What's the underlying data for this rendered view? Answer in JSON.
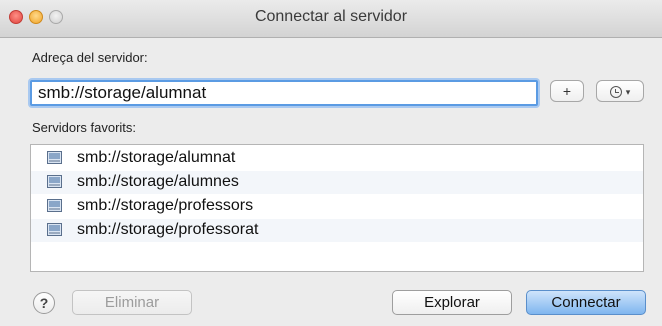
{
  "window": {
    "title": "Connectar al servidor"
  },
  "address": {
    "label": "Adreça del servidor:",
    "value": "smb://storage/alumnat"
  },
  "toolbar": {
    "add_label": "+",
    "recent_icon": "clock-icon",
    "recent_caret": "▾"
  },
  "favorites": {
    "label": "Servidors favorits:",
    "items": [
      {
        "label": "smb://storage/alumnat",
        "icon": "server-icon"
      },
      {
        "label": "smb://storage/alumnes",
        "icon": "server-icon"
      },
      {
        "label": "smb://storage/professors",
        "icon": "server-icon"
      },
      {
        "label": "smb://storage/professorat",
        "icon": "server-icon"
      }
    ]
  },
  "footer": {
    "help_label": "?",
    "remove_label": "Eliminar",
    "browse_label": "Explorar",
    "connect_label": "Connectar"
  },
  "colors": {
    "focus_ring": "#5b9be3",
    "default_button": "#7fb6ef",
    "close_button": "#e0443e",
    "minimize_button": "#f0a429"
  }
}
